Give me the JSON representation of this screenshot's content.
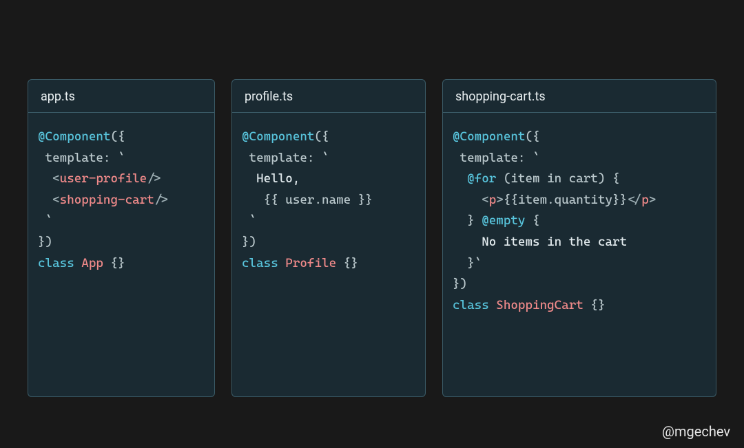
{
  "credit": "@mgechev",
  "panels": [
    {
      "filename": "app.ts",
      "code": {
        "decorator": "@Component",
        "decoratorOpen": "({",
        "templateKey": "template",
        "templateColon": ": `",
        "templateLines": [
          {
            "kind": "tag",
            "open": "<",
            "name": "user-profile",
            "close": "/>"
          },
          {
            "kind": "tag",
            "open": "<",
            "name": "shopping-cart",
            "close": "/>"
          }
        ],
        "templateEnd": "`",
        "decoratorClose": "})",
        "classKeyword": "class",
        "className": "App",
        "classBody": " {}"
      }
    },
    {
      "filename": "profile.ts",
      "code": {
        "decorator": "@Component",
        "decoratorOpen": "({",
        "templateKey": "template",
        "templateColon": ": `",
        "templateLines": [
          {
            "kind": "text",
            "text": "Hello,"
          },
          {
            "kind": "mustache",
            "text": "{{ user.name }}"
          }
        ],
        "templateEnd": "`",
        "decoratorClose": "})",
        "classKeyword": "class",
        "className": "Profile",
        "classBody": " {}"
      }
    },
    {
      "filename": "shopping-cart.ts",
      "code": {
        "decorator": "@Component",
        "decoratorOpen": "({",
        "templateKey": "template",
        "templateColon": ": `",
        "templateLines": [
          {
            "kind": "ctrl",
            "ctrl": "@for",
            "rest": " (item in cart) {"
          },
          {
            "kind": "html",
            "segments": [
              {
                "cls": "tok-angle",
                "t": "<"
              },
              {
                "cls": "tok-tag",
                "t": "p"
              },
              {
                "cls": "tok-angle",
                "t": ">"
              },
              {
                "cls": "tok-mustache",
                "t": "{{item.quantity}}"
              },
              {
                "cls": "tok-angle",
                "t": "</"
              },
              {
                "cls": "tok-tag",
                "t": "p"
              },
              {
                "cls": "tok-angle",
                "t": ">"
              }
            ]
          },
          {
            "kind": "ctrl2",
            "close": "}",
            "ctrl": "@empty",
            "open": "{"
          },
          {
            "kind": "text",
            "text": "No items in the cart"
          },
          {
            "kind": "closeTick",
            "text": "}`"
          }
        ],
        "templateEnd": "",
        "decoratorClose": "})",
        "classKeyword": "class",
        "className": "ShoppingCart",
        "classBody": " {}"
      }
    }
  ]
}
